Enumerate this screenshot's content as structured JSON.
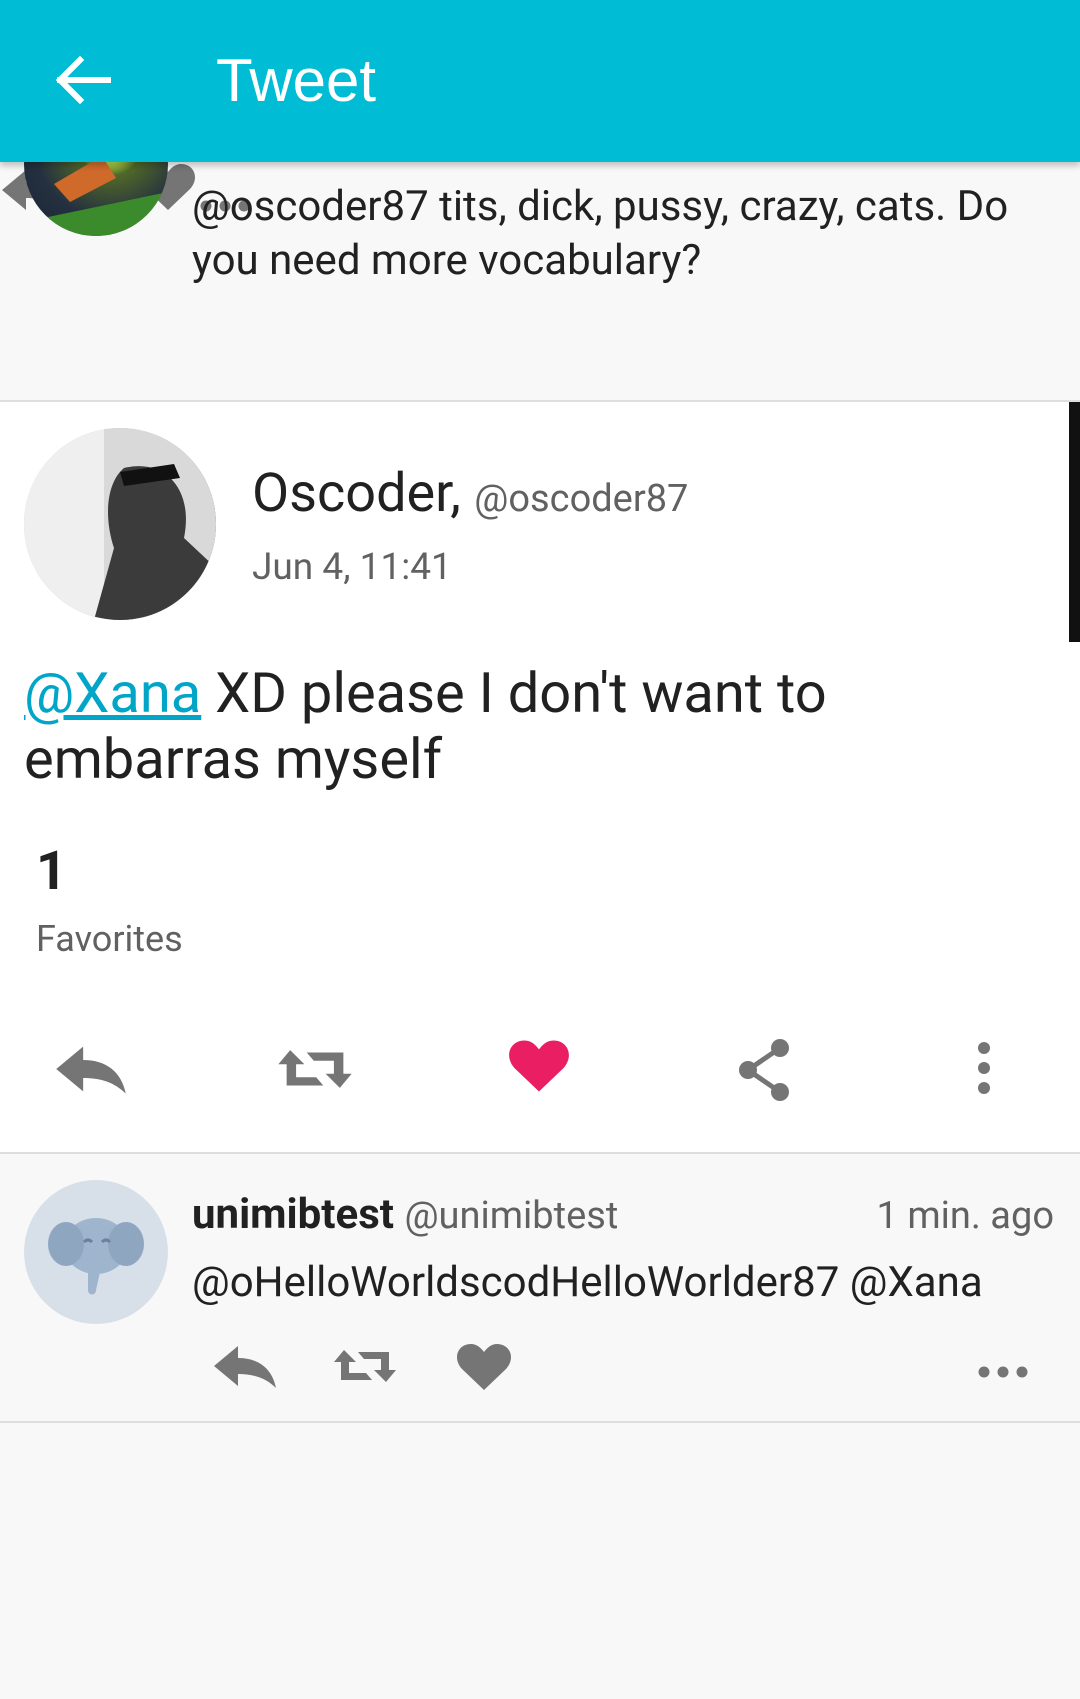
{
  "appbar": {
    "title": "Tweet",
    "back_icon": "arrow-back-icon"
  },
  "previous_tweet": {
    "text": "@oscoder87 tits, dick, pussy, crazy, cats. Do you need more vocabulary?"
  },
  "main_tweet": {
    "name": "Oscoder,",
    "handle": "@oscoder87",
    "date": "Jun 4, 11:41",
    "mention": "@Xana",
    "text": " XD please I don't want to embarras myself",
    "favorites_count": "1",
    "favorites_label": "Favorites",
    "colors": {
      "like_active": "#e91e63",
      "link": "#00a5c8"
    }
  },
  "reply_tweet": {
    "username": "unimibtest",
    "handle": "@unimibtest",
    "time": "1 min. ago",
    "text": "@oHelloWorldscodHelloWorlder87 @Xana"
  },
  "theme": {
    "appbar": "#00bcd4",
    "icon_gray": "#757575"
  }
}
